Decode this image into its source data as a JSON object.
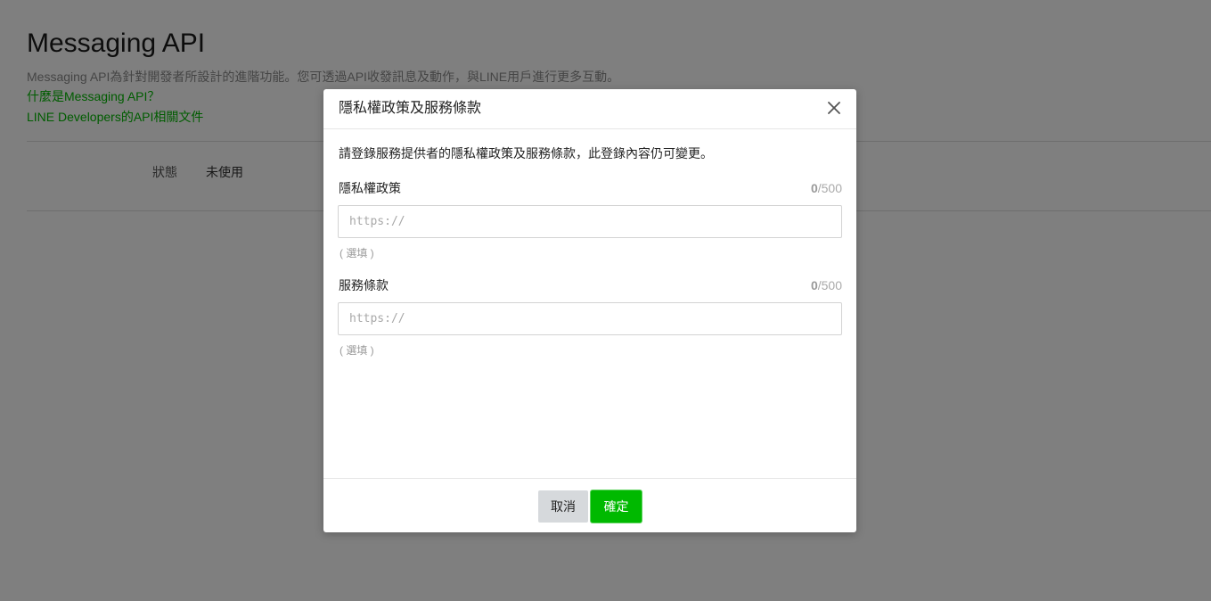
{
  "page": {
    "title": "Messaging API",
    "description": "Messaging API為針對開發者所設計的進階功能。您可透過API收發訊息及動作，與LINE用戶進行更多互動。",
    "links": [
      "什麼是Messaging API？",
      "LINE Developers的API相關文件"
    ],
    "status_label": "狀態",
    "status_value": "未使用"
  },
  "modal": {
    "title": "隱私權政策及服務條款",
    "intro": "請登錄服務提供者的隱私權政策及服務條款，此登錄內容仍可變更。",
    "fields": [
      {
        "label": "隱私權政策",
        "count": "0",
        "max": "/500",
        "value": "",
        "placeholder": "https://",
        "hint": "( 選填 )"
      },
      {
        "label": "服務條款",
        "count": "0",
        "max": "/500",
        "value": "",
        "placeholder": "https://",
        "hint": "( 選填 )"
      }
    ],
    "cancel_label": "取消",
    "confirm_label": "確定"
  },
  "colors": {
    "brand_green": "#00b900",
    "overlay": "rgba(0,0,0,0.5)"
  },
  "icons": {
    "close": "close-icon"
  }
}
